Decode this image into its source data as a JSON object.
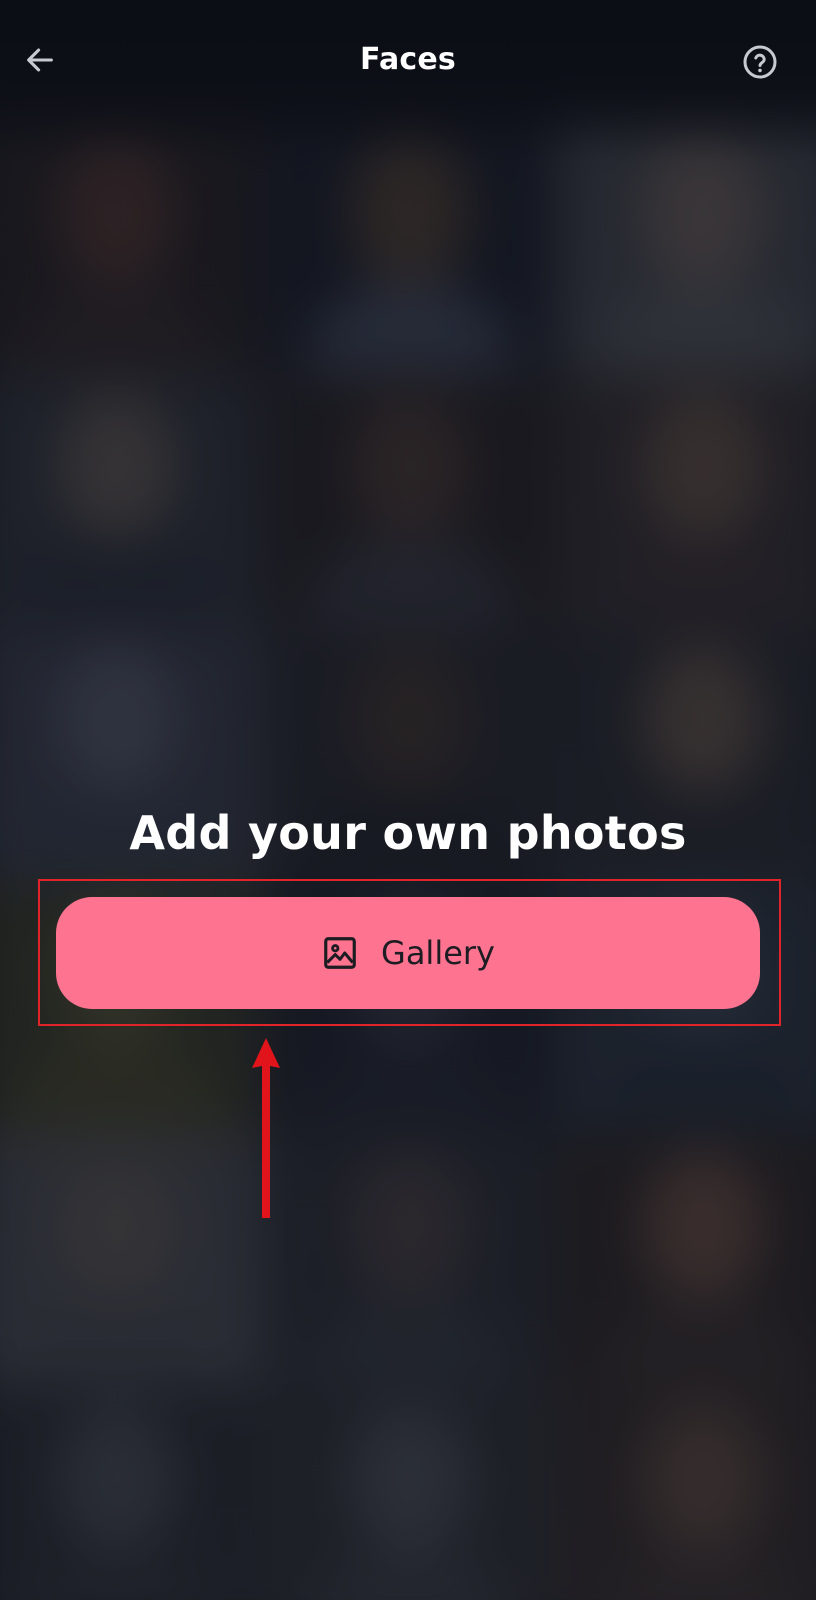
{
  "header": {
    "title": "Faces",
    "back_icon": "arrow-left-icon",
    "help_icon": "help-circle-icon"
  },
  "main": {
    "heading": "Add your own photos",
    "gallery_button": {
      "label": "Gallery",
      "icon": "image-icon",
      "color": "#fe7390"
    }
  },
  "annotation": {
    "highlight_color": "#e0242a",
    "arrow_color": "#e0141a"
  }
}
